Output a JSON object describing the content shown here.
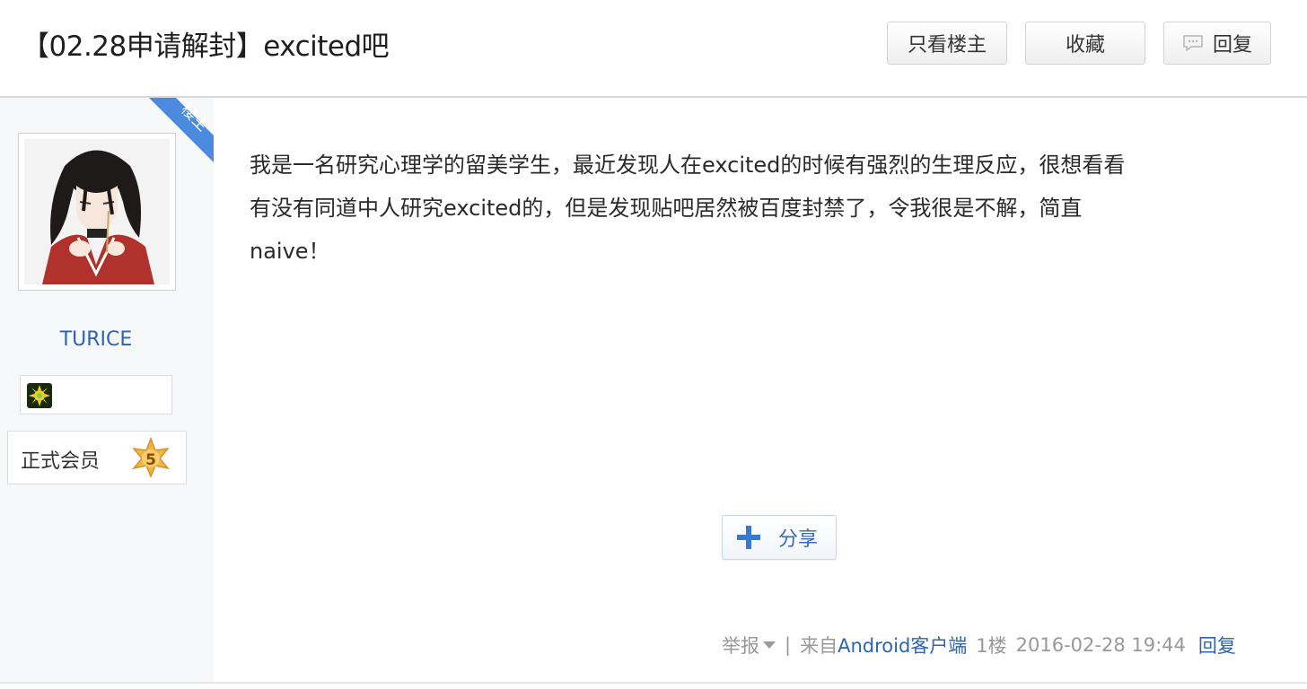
{
  "thread": {
    "title": "【02.28申请解封】excited吧"
  },
  "header_buttons": {
    "only_op": "只看楼主",
    "favorite": "收藏",
    "reply": "回复"
  },
  "author": {
    "op_badge": "楼主",
    "username": "TURICE",
    "member_level_label": "正式会员",
    "level_number": "5"
  },
  "post": {
    "line1": "我是一名研究心理学的留美学生，最近发现人在excited的时候有强烈的生理反应，很想看看",
    "line2": "有没有同道中人研究excited的，但是发现贴吧居然被百度封禁了，令我很是不解，简直",
    "line3": "naive！"
  },
  "share": {
    "label": "分享"
  },
  "footer": {
    "report": "举报",
    "divider": "|",
    "from_prefix": "来自",
    "client": "Android客户端",
    "floor": "1楼",
    "timestamp": "2016-02-28 19:44",
    "reply": "回复"
  },
  "colors": {
    "link_blue": "#2d64b3",
    "op_badge_blue": "#4a8be0",
    "sidebar_bg": "#f7f8fa"
  },
  "icons": {
    "reply": "speech-bubble-icon",
    "share": "plus-icon",
    "level": "star-badge-icon",
    "honor": "sun-badge-icon",
    "report_dropdown": "caret-down-icon"
  }
}
